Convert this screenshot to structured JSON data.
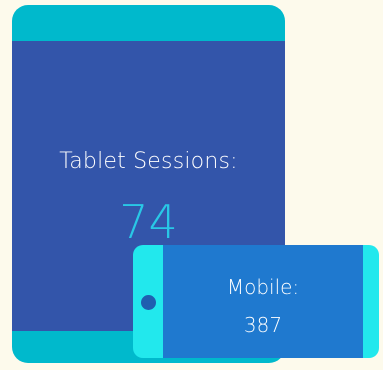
{
  "tablet": {
    "label": "Tablet Sessions:",
    "value": "74",
    "frame_color": "#00b9cc",
    "screen_color": "#3355aa",
    "value_color": "#29c8e6"
  },
  "mobile": {
    "label": "Mobile:",
    "value": "387",
    "frame_color": "#22e8ed",
    "screen_color": "#1f79cf"
  },
  "background_color": "#fdfaec"
}
